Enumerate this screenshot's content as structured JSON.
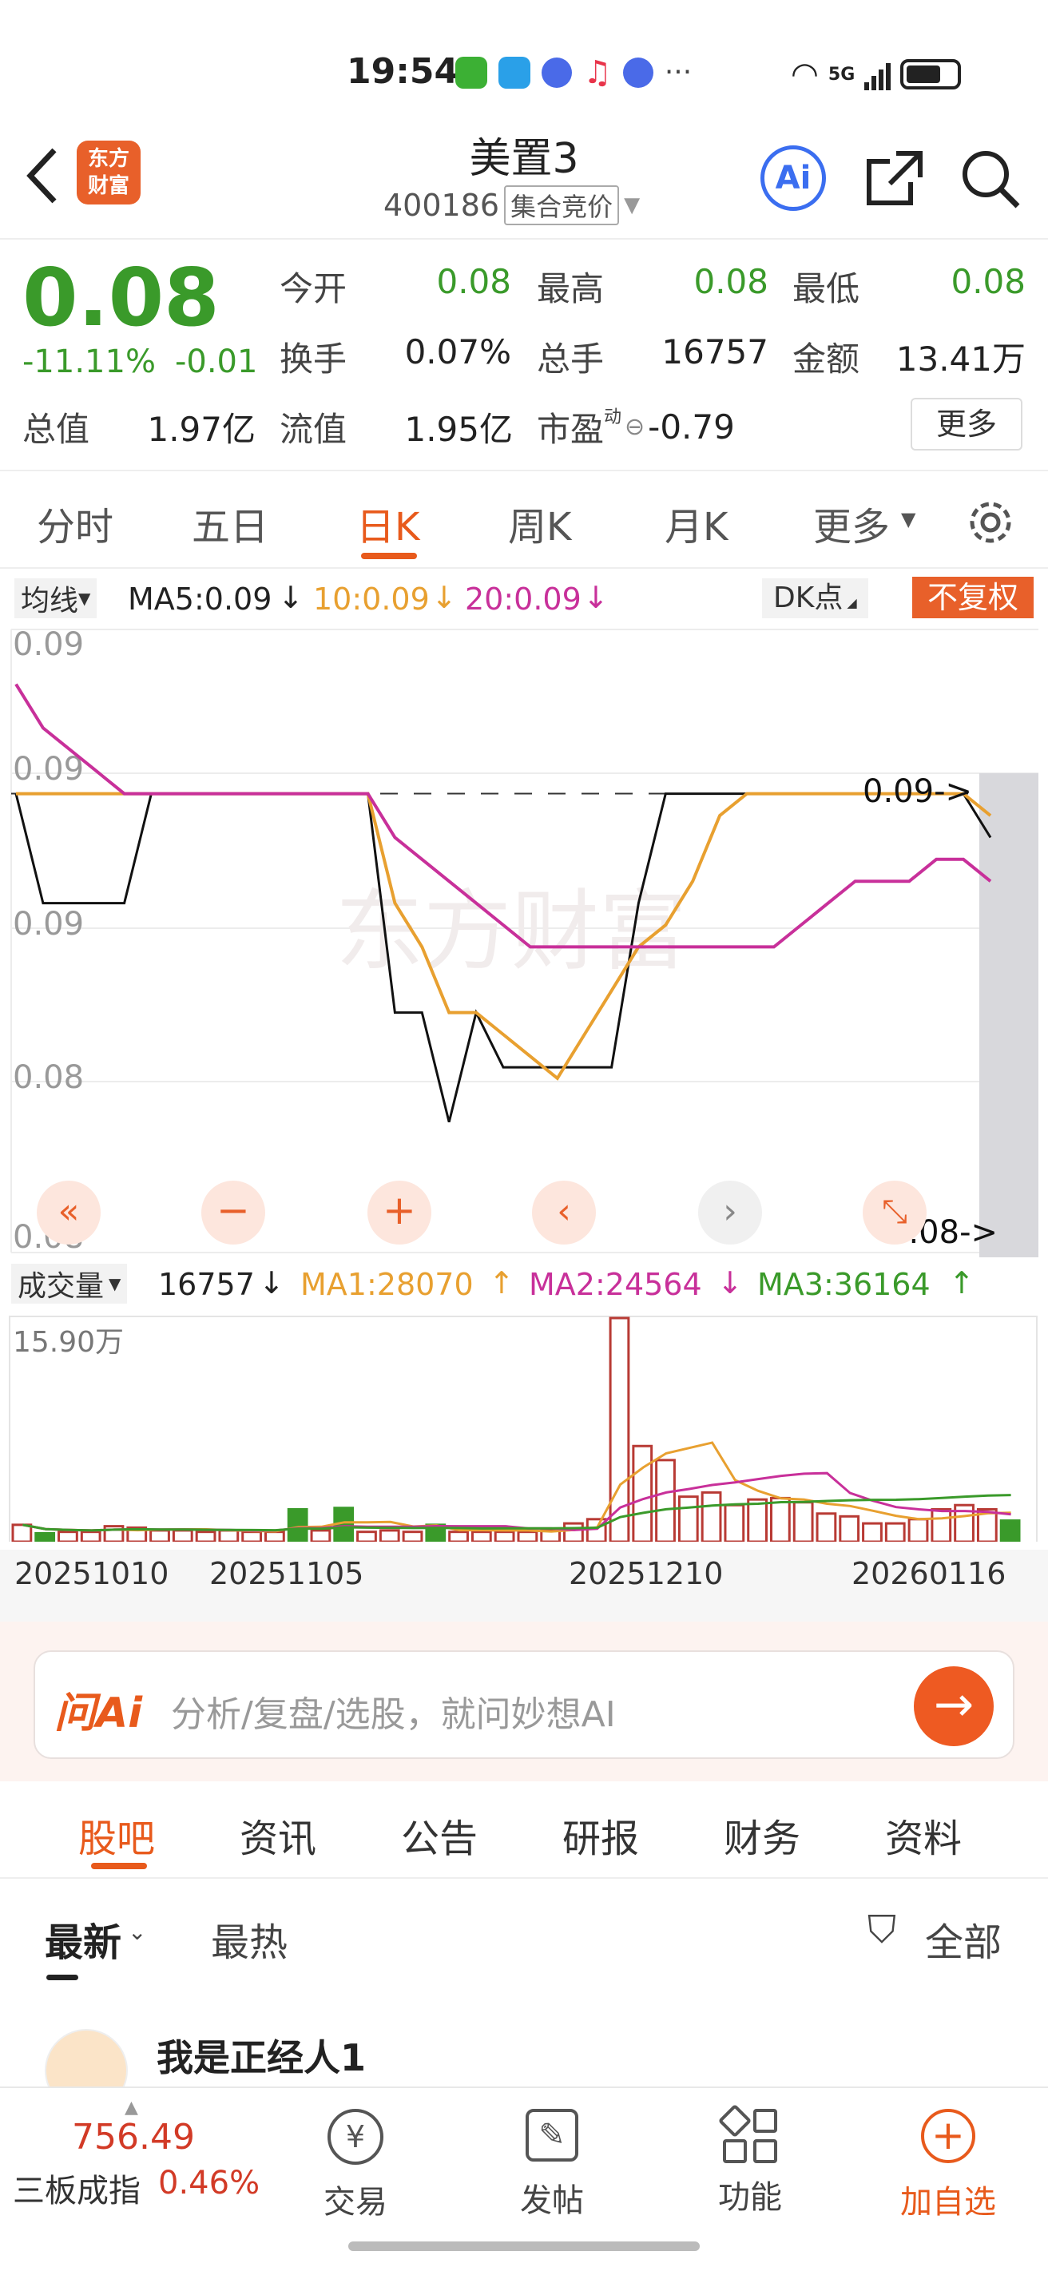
{
  "status_bar": {
    "time": "19:54",
    "network": "5G"
  },
  "header": {
    "title": "美置3",
    "code": "400186",
    "auction_badge": "集合竞价",
    "logo_text": "东方\n财富",
    "ai_label": "Ai"
  },
  "quote": {
    "price": "0.08",
    "change_pct": "-11.11%",
    "change_abs": "-0.01",
    "fields": [
      {
        "label": "今开",
        "value": "0.08"
      },
      {
        "label": "最高",
        "value": "0.08"
      },
      {
        "label": "最低",
        "value": "0.08"
      },
      {
        "label": "换手",
        "value": "0.07%"
      },
      {
        "label": "总手",
        "value": "16757"
      },
      {
        "label": "金额",
        "value": "13.41万"
      }
    ],
    "total_value_label": "总值",
    "total_value": "1.97亿",
    "float_value_label": "流值",
    "float_value": "1.95亿",
    "pe_label": "市盈",
    "pe_superscript": "动",
    "pe_value": "-0.79",
    "more_button": "更多"
  },
  "chart_tabs": {
    "items": [
      "分时",
      "五日",
      "日K",
      "周K",
      "月K",
      "更多"
    ],
    "active": 2
  },
  "ma_bar": {
    "type_label": "均线",
    "ma5": "MA5:0.09",
    "ma10": "10:0.09",
    "ma20": "20:0.09",
    "dk_label": "DK点",
    "fq_label": "不复权"
  },
  "kline": {
    "y_labels": [
      "0.09",
      "0.09",
      "0.09",
      "0.08",
      "0.08"
    ],
    "right_top": "0.09->",
    "right_bottom": "0.08->",
    "watermark": "东方财富"
  },
  "volume_bar": {
    "label": "成交量",
    "value": "16757",
    "ma1": "MA1:28070",
    "ma2": "MA2:24564",
    "ma3": "MA3:36164",
    "scale_label": "15.90万"
  },
  "x_dates": [
    "20251010",
    "20251105",
    "20251210",
    "20260116"
  ],
  "ask_ai": {
    "brand": "问Ai",
    "placeholder": "分析/复盘/选股，就问妙想AI"
  },
  "section_tabs": {
    "items": [
      "股吧",
      "资讯",
      "公告",
      "研报",
      "财务",
      "资料"
    ],
    "active": 0
  },
  "feed": {
    "sort_latest": "最新",
    "sort_hot": "最热",
    "filter": "全部",
    "first_user": "我是正经人1"
  },
  "bottom_nav": {
    "index_value": "756.49",
    "index_name": "三板成指",
    "index_change": "0.46%",
    "items": [
      "交易",
      "发帖",
      "功能",
      "加自选"
    ]
  },
  "chart_data": [
    {
      "type": "line",
      "title": "日K",
      "series": [
        {
          "name": "收盘",
          "color": "#111111",
          "values": [
            0.09,
            0.085,
            0.085,
            0.085,
            0.085,
            0.09,
            0.09,
            0.09,
            0.09,
            0.09,
            0.09,
            0.09,
            0.09,
            0.09,
            0.08,
            0.08,
            0.075,
            0.08,
            0.0775,
            0.0775,
            0.0775,
            0.0775,
            0.0775,
            0.085,
            0.09,
            0.09,
            0.09,
            0.09,
            0.09,
            0.09,
            0.09,
            0.09,
            0.09,
            0.09,
            0.09,
            0.09,
            0.088
          ]
        },
        {
          "name": "MA5",
          "color": "#e8a030",
          "values": [
            0.09,
            0.09,
            0.09,
            0.09,
            0.09,
            0.09,
            0.09,
            0.09,
            0.09,
            0.09,
            0.09,
            0.09,
            0.09,
            0.09,
            0.085,
            0.083,
            0.08,
            0.08,
            0.079,
            0.078,
            0.077,
            0.079,
            0.081,
            0.083,
            0.084,
            0.086,
            0.089,
            0.09,
            0.09,
            0.09,
            0.09,
            0.09,
            0.09,
            0.09,
            0.09,
            0.09,
            0.089
          ]
        },
        {
          "name": "MA10",
          "color": "#c8309a",
          "values": [
            0.095,
            0.093,
            0.092,
            0.091,
            0.09,
            0.09,
            0.09,
            0.09,
            0.09,
            0.09,
            0.09,
            0.09,
            0.09,
            0.09,
            0.088,
            0.087,
            0.086,
            0.085,
            0.084,
            0.083,
            0.083,
            0.083,
            0.083,
            0.083,
            0.083,
            0.083,
            0.083,
            0.083,
            0.083,
            0.084,
            0.085,
            0.086,
            0.086,
            0.086,
            0.087,
            0.087,
            0.086
          ]
        }
      ]
    },
    {
      "type": "bar",
      "title": "成交量",
      "ylabel": "15.90万",
      "values": [
        1.2,
        0.6,
        0.7,
        0.7,
        1.1,
        1.0,
        0.8,
        0.8,
        0.7,
        0.8,
        0.7,
        0.7,
        2.3,
        0.8,
        2.4,
        0.7,
        0.8,
        0.7,
        1.2,
        0.7,
        0.7,
        0.7,
        0.7,
        0.8,
        1.3,
        1.6,
        15.9,
        6.8,
        5.8,
        3.2,
        3.5,
        2.6,
        3.0,
        3.1,
        2.8,
        2.0,
        1.8,
        1.3,
        1.3,
        1.6,
        2.3,
        2.6,
        2.3,
        1.5
      ],
      "rising": [
        false,
        true,
        false,
        false,
        false,
        false,
        false,
        false,
        false,
        false,
        false,
        false,
        true,
        false,
        true,
        false,
        false,
        false,
        true,
        false,
        false,
        false,
        false,
        false,
        false,
        false,
        false,
        false,
        false,
        false,
        false,
        false,
        false,
        false,
        false,
        false,
        false,
        false,
        false,
        false,
        false,
        false,
        false,
        true
      ]
    }
  ]
}
